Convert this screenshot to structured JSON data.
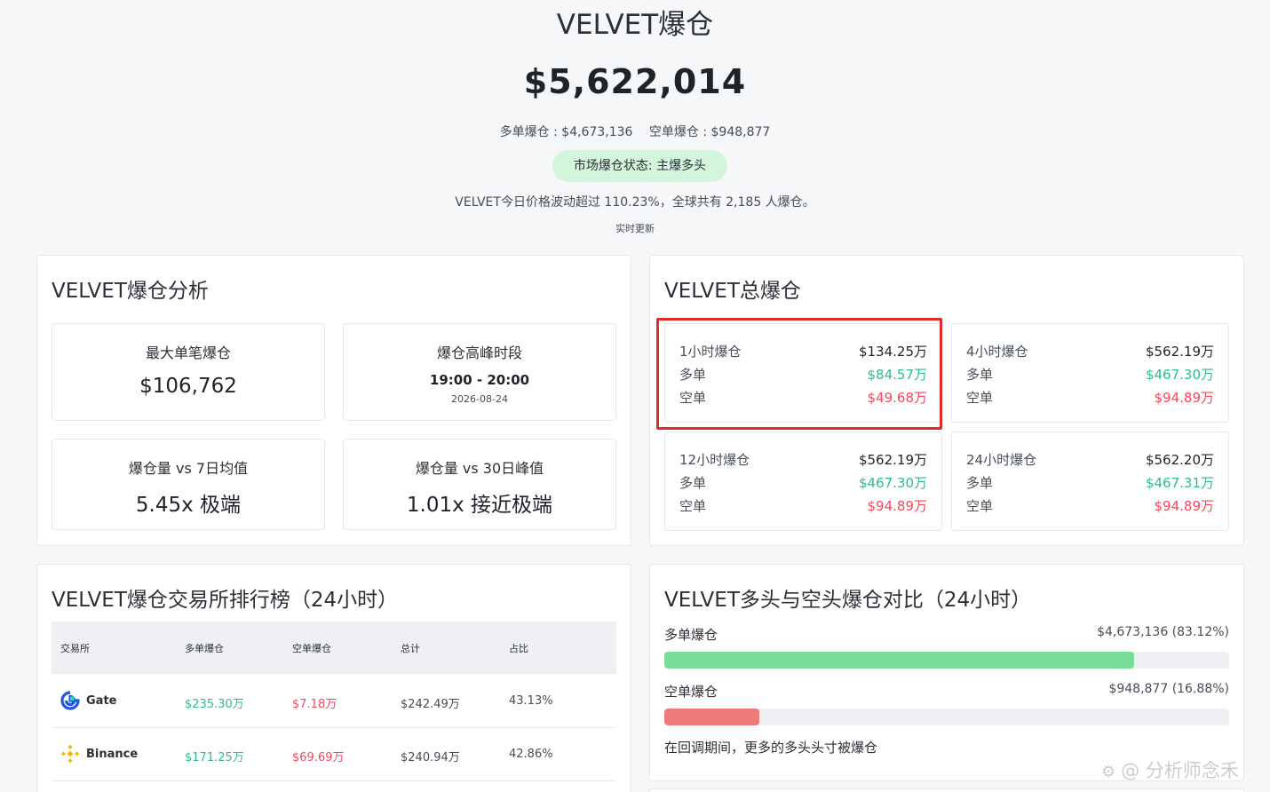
{
  "header": {
    "title": "VELVET爆仓",
    "total": "$5,622,014",
    "long_text": "多单爆仓 : $4,673,136",
    "short_text": "空单爆仓 : $948,877",
    "status": "市场爆仓状态: 主爆多头",
    "description": "VELVET今日价格波动超过 110.23%，全球共有 2,185 人爆仓。",
    "update": "实时更新"
  },
  "analysis": {
    "title": "VELVET爆仓分析",
    "stats": [
      {
        "label": "最大单笔爆仓",
        "value": "$106,762"
      },
      {
        "label": "爆仓高峰时段",
        "value": "19:00 - 20:00",
        "sub": "2026-08-24"
      },
      {
        "label": "爆仓量 vs 7日均值",
        "value": "5.45x 极端"
      },
      {
        "label": "爆仓量 vs 30日峰值",
        "value": "1.01x 接近极端"
      }
    ]
  },
  "totals": {
    "title": "VELVET总爆仓",
    "long_label": "多单",
    "short_label": "空单",
    "periods": [
      {
        "label": "1小时爆仓",
        "total": "$134.25万",
        "long": "$84.57万",
        "short": "$49.68万"
      },
      {
        "label": "4小时爆仓",
        "total": "$562.19万",
        "long": "$467.30万",
        "short": "$94.89万"
      },
      {
        "label": "12小时爆仓",
        "total": "$562.19万",
        "long": "$467.30万",
        "short": "$94.89万"
      },
      {
        "label": "24小时爆仓",
        "total": "$562.20万",
        "long": "$467.31万",
        "short": "$94.89万"
      }
    ]
  },
  "ranking": {
    "title": "VELVET爆仓交易所排行榜（24小时）",
    "columns": [
      "交易所",
      "多单爆仓",
      "空单爆仓",
      "总计",
      "占比"
    ],
    "rows": [
      {
        "exchange": "Gate",
        "icon": "gate-logo-icon",
        "long": "$235.30万",
        "short": "$7.18万",
        "total": "$242.49万",
        "share": "43.13%"
      },
      {
        "exchange": "Binance",
        "icon": "binance-logo-icon",
        "long": "$171.25万",
        "short": "$69.69万",
        "total": "$240.94万",
        "share": "42.86%"
      }
    ]
  },
  "comparison": {
    "title": "VELVET多头与空头爆仓对比（24小时）",
    "long_label": "多单爆仓",
    "long_value": "$4,673,136 (83.12%)",
    "long_pct": 83.12,
    "short_label": "空单爆仓",
    "short_value": "$948,877 (16.88%)",
    "short_pct": 16.88,
    "note": "在回调期间，更多的多头头寸被爆仓",
    "colors": {
      "long": "#77dd99",
      "short": "#ef7a7a"
    }
  },
  "watermark": {
    "text": "@ 分析师念禾",
    "icon": "gear-badge-icon"
  }
}
